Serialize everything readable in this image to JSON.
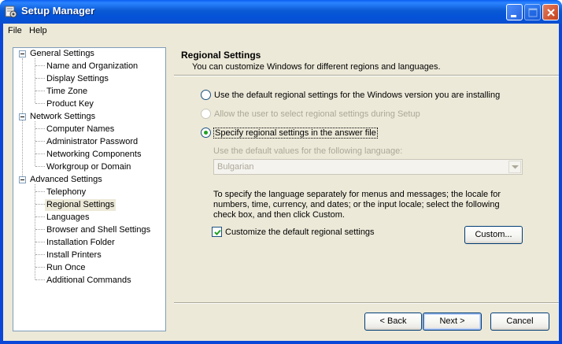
{
  "window": {
    "title": "Setup Manager"
  },
  "menu": [
    "File",
    "Help"
  ],
  "tree": [
    {
      "label": "General Settings",
      "children": [
        "Name and Organization",
        "Display Settings",
        "Time Zone",
        "Product Key"
      ]
    },
    {
      "label": "Network Settings",
      "children": [
        "Computer Names",
        "Administrator Password",
        "Networking Components",
        "Workgroup or Domain"
      ]
    },
    {
      "label": "Advanced Settings",
      "children": [
        "Telephony",
        "Regional Settings",
        "Languages",
        "Browser and Shell Settings",
        "Installation Folder",
        "Install Printers",
        "Run Once",
        "Additional Commands"
      ]
    }
  ],
  "selected_item": "Regional Settings",
  "page": {
    "heading": "Regional Settings",
    "subheading": "You can customize Windows for different regions and languages.",
    "option_default": "Use the default regional settings for the Windows version you are installing",
    "option_user": "Allow the user to select regional settings during Setup",
    "option_specify": "Specify regional settings in the answer file",
    "selected_option": "option_specify",
    "language_label": "Use the default values for the following language:",
    "language_value": "Bulgarian",
    "instructions": "To specify the language separately for menus and messages; the locale for numbers, time, currency, and dates; or the input locale; select the following check box, and then click Custom.",
    "customize_label": "Customize the default regional settings",
    "customize_checked": true,
    "custom_button": "Custom..."
  },
  "buttons": {
    "back": "< Back",
    "next": "Next >",
    "cancel": "Cancel"
  }
}
